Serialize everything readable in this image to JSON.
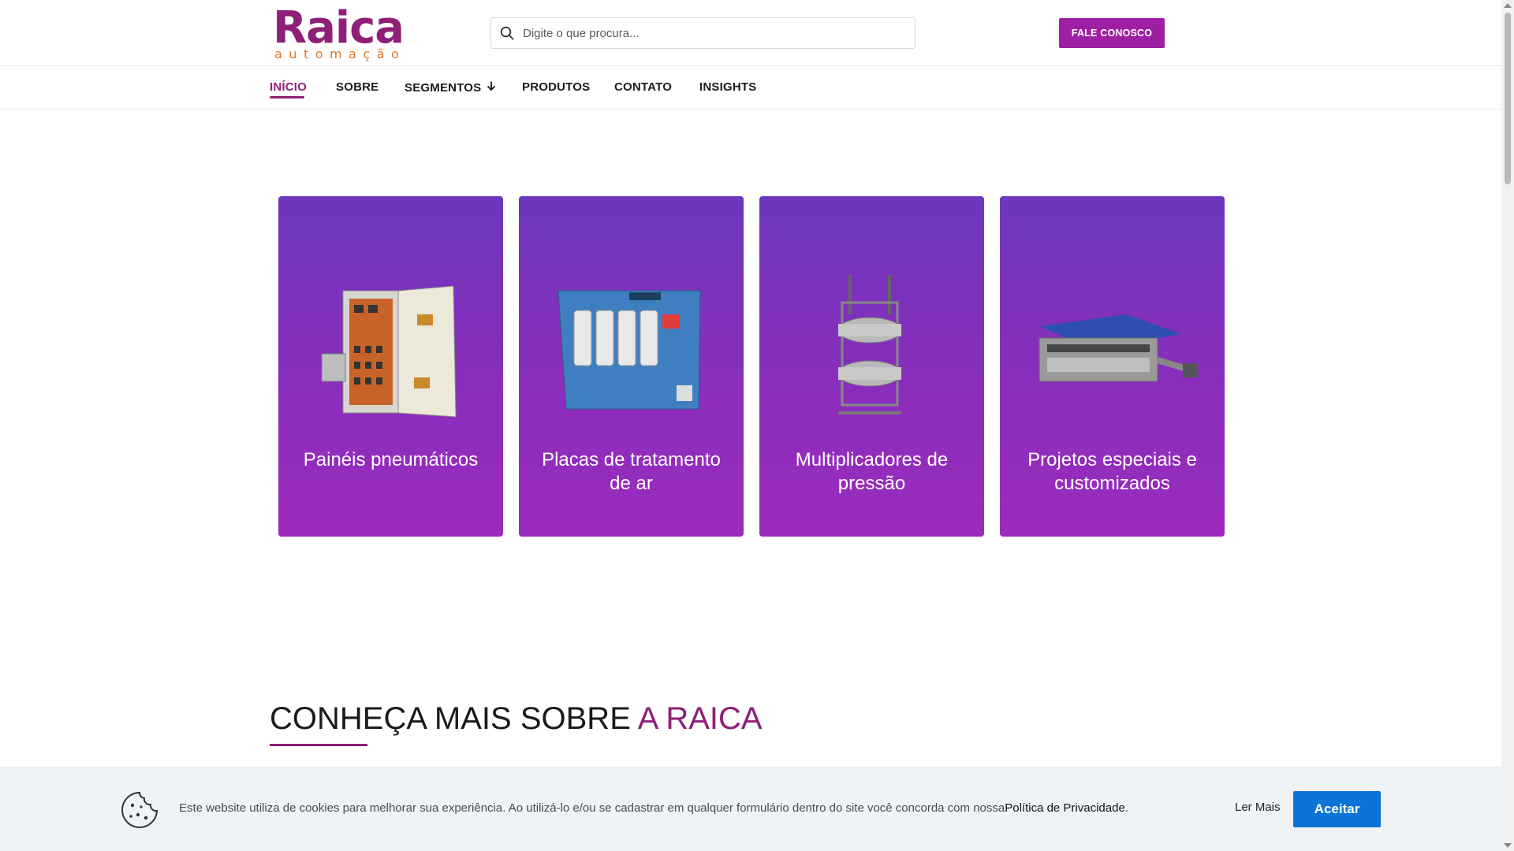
{
  "brand": {
    "name": "Raica",
    "tagline": "automação",
    "colors": {
      "primary": "#8e1f78",
      "accent": "#e0782a",
      "button": "#9e1fa3",
      "card_gradient_top": "#6c37bd",
      "card_gradient_bottom": "#9b2bbd",
      "cookie_button": "#0c74d6"
    }
  },
  "search": {
    "placeholder": "Digite o que procura...",
    "icon": "search-icon"
  },
  "header": {
    "cta_label": "FALE CONOSCO"
  },
  "nav": {
    "items": [
      {
        "label": "INÍCIO",
        "active": true
      },
      {
        "label": "SOBRE"
      },
      {
        "label": "SEGMENTOS",
        "icon": "arrow-down-icon"
      },
      {
        "label": "PRODUTOS"
      },
      {
        "label": "CONTATO"
      },
      {
        "label": "INSIGHTS"
      }
    ]
  },
  "cards": [
    {
      "title": "Painéis pneumáticos",
      "image": "pneumatic-panel"
    },
    {
      "title": "Placas de tratamento de ar",
      "image": "air-treatment-plate"
    },
    {
      "title": "Multiplicadores de pressão",
      "image": "pressure-multiplier"
    },
    {
      "title": "Projetos especiais e customizados",
      "image": "custom-project"
    }
  ],
  "section": {
    "title_prefix": "CONHEÇA MAIS SOBRE ",
    "title_accent": "A RAICA"
  },
  "cookie": {
    "text": "Este website utiliza de cookies para melhorar sua experiência. Ao utilizá-lo e/ou se cadastrar em qualquer formulário dentro do site você concorda com nossa",
    "link": "Política de Privacidade",
    "suffix": ".",
    "read_more": "Ler Mais",
    "accept": "Aceitar",
    "icon": "cookie-icon"
  }
}
